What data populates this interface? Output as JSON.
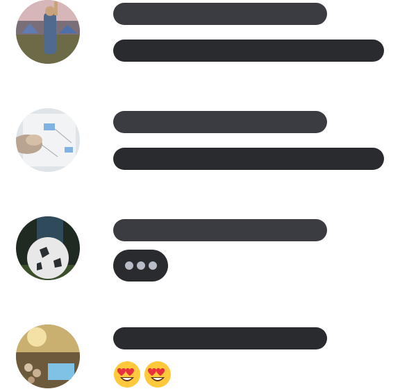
{
  "messages": [
    {
      "avatar": "camping-festival-photo",
      "lines": [
        "short",
        "long"
      ]
    },
    {
      "avatar": "whiteboard-planning-photo",
      "lines": [
        "short",
        "long"
      ]
    },
    {
      "avatar": "soccer-ball-photo",
      "lines": [
        "short"
      ],
      "typing_indicator": true
    },
    {
      "avatar": "pool-party-photo",
      "lines": [
        "short"
      ],
      "reactions": [
        "heart-eyes-emoji",
        "heart-eyes-emoji"
      ]
    }
  ],
  "colors": {
    "bar_light": "#3a3c41",
    "bar_dark": "#2a2b2f",
    "typing_dot": "#b8bcc6"
  }
}
